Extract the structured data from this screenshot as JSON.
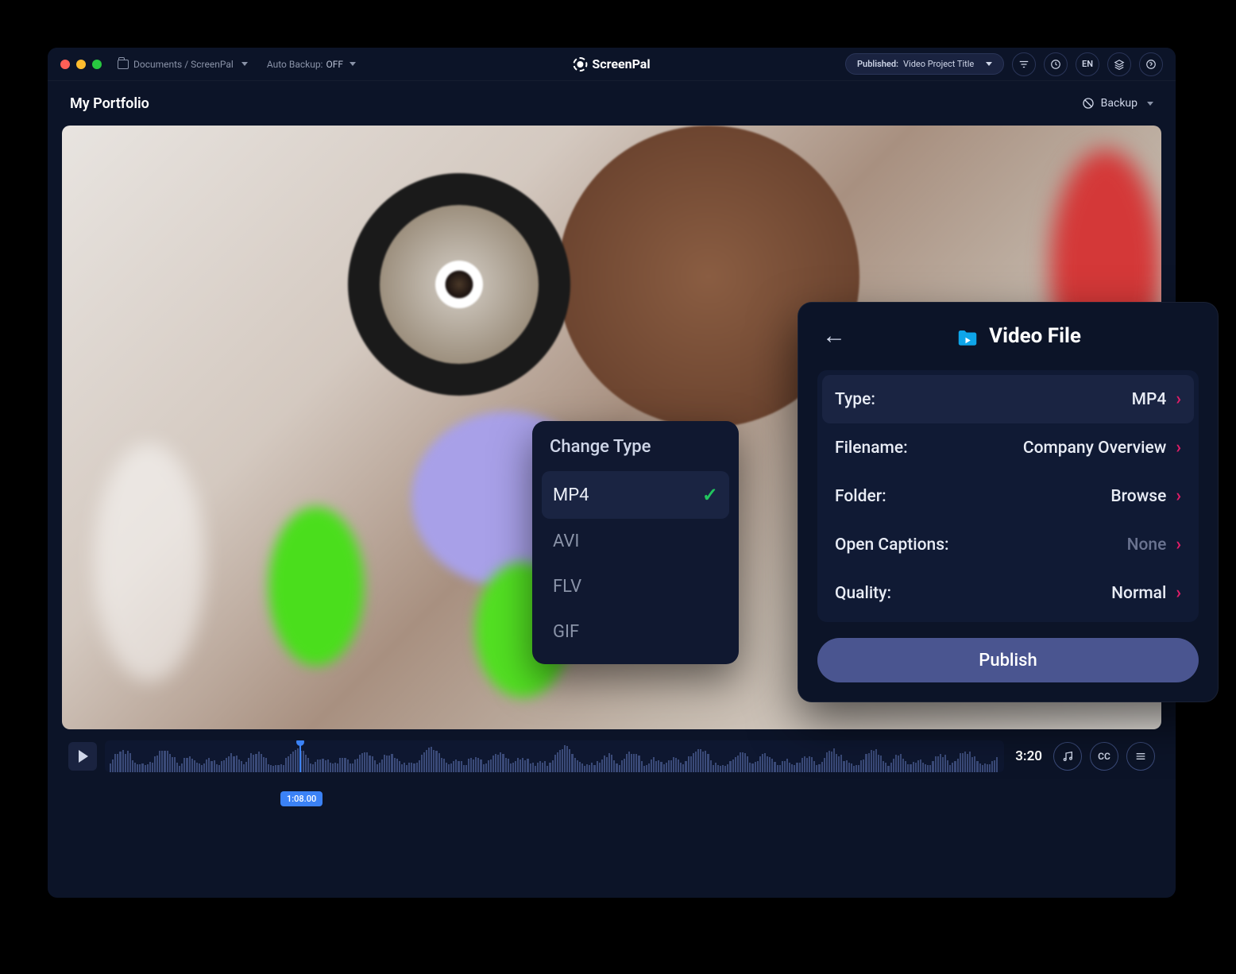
{
  "titlebar": {
    "breadcrumb": "Documents / ScreenPal",
    "autobackup_label": "Auto Backup:",
    "autobackup_value": "OFF"
  },
  "brand": "ScreenPal",
  "publish_select": {
    "label": "Published:",
    "value": "Video Project Title"
  },
  "lang_btn": "EN",
  "subheader": {
    "title": "My Portfolio",
    "backup_label": "Backup"
  },
  "timeline": {
    "playhead_time": "1:08.00",
    "total_time": "3:20",
    "cc_label": "CC"
  },
  "change_type": {
    "title": "Change Type",
    "options": [
      "MP4",
      "AVI",
      "FLV",
      "GIF"
    ],
    "selected_index": 0
  },
  "video_file": {
    "title": "Video File",
    "rows": [
      {
        "label": "Type:",
        "value": "MP4",
        "muted": false,
        "selected": true
      },
      {
        "label": "Filename:",
        "value": "Company Overview",
        "muted": false,
        "selected": false
      },
      {
        "label": "Folder:",
        "value": "Browse",
        "muted": false,
        "selected": false
      },
      {
        "label": "Open Captions:",
        "value": "None",
        "muted": true,
        "selected": false
      },
      {
        "label": "Quality:",
        "value": "Normal",
        "muted": false,
        "selected": false
      }
    ],
    "publish_label": "Publish"
  }
}
